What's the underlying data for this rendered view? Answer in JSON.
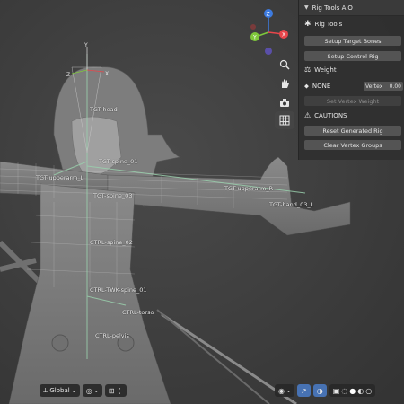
{
  "panel": {
    "title": "Rig Tools AIO",
    "rig_tools_label": "Rig Tools",
    "setup_target_bones": "Setup Target Bones",
    "setup_control_rig": "Setup Control Rig",
    "weight_label": "Weight",
    "none_label": "NONE",
    "vertex_label": "Vertex",
    "vertex_value": "0.00",
    "set_vertex_weight": "Set Vertex Weight",
    "cautions_label": "CAUTIONS",
    "reset_generated_rig": "Reset Generated Rig",
    "clear_vertex_groups": "Clear Vertex Groups"
  },
  "gizmo": {
    "z": "Z",
    "y": "Y",
    "x": "X",
    "colors": {
      "x": "#e8464b",
      "y": "#7ec83b",
      "z": "#3d7be0"
    }
  },
  "bottom_bar": {
    "orientation": "Global"
  },
  "bone_labels": [
    "TGT-head",
    "TGT-spine_01",
    "TGT-upperarm_L",
    "TGT-spine_03",
    "CTRL-spine_02",
    "CTRL-TWK-spine_01",
    "CTRL-torso",
    "CTRL-pelvis",
    "TGT-upperarm_R",
    "TGT-hand_03_L"
  ],
  "axis_labels": {
    "y": "Y",
    "z": "Z",
    "x": "X"
  },
  "icons": [
    "zoom-icon",
    "hand-pan-icon",
    "camera-icon",
    "grid-icon",
    "rig-tools-icon",
    "weight-icon",
    "none-icon",
    "warning-icon"
  ]
}
